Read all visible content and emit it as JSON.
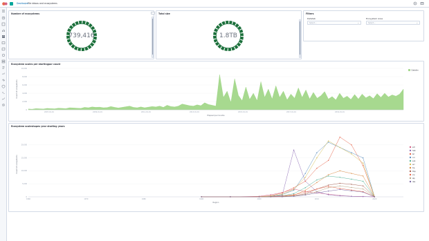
{
  "header": {
    "breadcrumb_root": "Dashboard",
    "breadcrumb_sep": "/",
    "breadcrumb_current": "File ddoos and ecosystems"
  },
  "panels": {
    "count": {
      "title": "Number of ecosystems",
      "value": "739,416",
      "button_label": "..."
    },
    "size": {
      "title": "Total size",
      "value": "1.8TB"
    },
    "filters": {
      "title": "Filters",
      "control1_label": "Datatab",
      "control1_placeholder": "Select...",
      "control2_label": "Ecosystem Area",
      "control2_placeholder": "Select..."
    }
  },
  "colors": {
    "accent": "#1a6f3a",
    "area": "#a7d98f",
    "brand": "#e7664c"
  },
  "chart_data": [
    {
      "type": "area",
      "title": "Ecosystem scales per startingpar count",
      "xlabel": "Elapsed per bundle",
      "ylabel": "Count of ecosystems",
      "ylim": [
        0,
        10000
      ],
      "y_ticks": [
        "10,000",
        "8,000",
        "6,000",
        "4,000",
        "2,000",
        "0"
      ],
      "x_ticks": [
        "2007-01-01",
        "2009-01-01",
        "2011-01-01",
        "2013-01-01",
        "2015-01-01",
        "2017-01-01",
        "2019-01-01"
      ],
      "legend": [
        "Datalim"
      ],
      "legend_position": "top-right",
      "x": [
        0,
        2,
        4,
        6,
        8,
        10,
        12,
        14,
        16,
        18,
        20,
        22,
        24,
        26,
        28,
        30,
        32,
        34,
        36,
        38,
        40,
        42,
        44,
        46,
        48,
        50,
        52,
        54,
        56,
        58,
        60,
        62,
        64,
        66,
        68,
        70,
        72,
        74,
        76,
        78,
        80,
        82,
        84,
        86,
        88,
        90,
        92,
        94,
        96,
        98,
        100,
        102,
        104,
        106,
        108,
        110,
        112,
        114,
        116,
        118,
        120,
        122,
        124,
        126,
        128,
        130,
        132,
        134,
        136,
        138,
        140,
        142,
        144,
        146,
        148,
        150,
        152,
        154,
        156,
        158,
        160,
        162,
        164,
        166,
        168,
        170,
        172,
        174,
        176,
        178,
        180,
        182,
        184,
        186,
        188,
        190,
        192,
        194,
        196,
        198,
        200
      ],
      "values": [
        200,
        150,
        300,
        250,
        200,
        350,
        300,
        250,
        400,
        350,
        300,
        500,
        450,
        400,
        350,
        600,
        500,
        700,
        600,
        650,
        500,
        550,
        800,
        600,
        450,
        600,
        750,
        900,
        600,
        500,
        700,
        500,
        650,
        800,
        700,
        900,
        600,
        1100,
        800,
        700,
        900,
        1400,
        1200,
        1000,
        900,
        1200,
        1000,
        1700,
        1300,
        1100,
        900,
        8500,
        3000,
        4500,
        1800,
        7500,
        3500,
        2200,
        5500,
        2500,
        4000,
        2200,
        6800,
        3000,
        5000,
        2600,
        5800,
        3000,
        4500,
        2400,
        3800,
        2800,
        5300,
        3000,
        4800,
        2600,
        4200,
        2800,
        3400,
        4400,
        2600,
        3200,
        2400,
        4000,
        2800,
        3300,
        2500,
        3700,
        2600,
        3800,
        2900,
        3400,
        2700,
        3900,
        3000,
        4000,
        3100,
        3600,
        3300,
        3800,
        5000
      ]
    },
    {
      "type": "line",
      "title": "Ecosystem scaleshapes year starting years",
      "xlabel": "Region",
      "ylabel": "Count of ecosystems",
      "ylim": [
        0,
        25000
      ],
      "y_ticks": [
        "20,000",
        "15,000",
        "10,000",
        "5,000",
        "0"
      ],
      "x_ticks": [
        "1960",
        "1970",
        "1980",
        "1990",
        "2000",
        "2010",
        "2020"
      ],
      "legend_position": "right",
      "x": [
        1990,
        1995,
        2000,
        2002,
        2004,
        2006,
        2008,
        2010,
        2012,
        2014,
        2016,
        2018,
        2020
      ],
      "series": [
        {
          "name": "sch",
          "color": "#d36086",
          "values": [
            0,
            0,
            200,
            800,
            1600,
            3000,
            2000,
            1500,
            1000,
            500,
            200,
            100,
            0
          ]
        },
        {
          "name": "hab",
          "color": "#9170b8",
          "values": [
            0,
            0,
            0,
            200,
            600,
            18000,
            6000,
            2000,
            800,
            400,
            200,
            100,
            0
          ]
        },
        {
          "name": "brl",
          "color": "#e7664c",
          "values": [
            0,
            0,
            100,
            400,
            1500,
            3500,
            6000,
            11000,
            14000,
            23000,
            20000,
            12000,
            0
          ]
        },
        {
          "name": "cor",
          "color": "#6092c0",
          "values": [
            0,
            0,
            0,
            300,
            900,
            2500,
            9000,
            17000,
            21000,
            19000,
            17000,
            15000,
            0
          ]
        },
        {
          "name": "sub",
          "color": "#54b399",
          "values": [
            0,
            0,
            0,
            100,
            400,
            1200,
            3500,
            6500,
            8000,
            7500,
            6800,
            6000,
            0
          ]
        },
        {
          "name": "arc",
          "color": "#d6bf57",
          "values": [
            0,
            0,
            100,
            300,
            1000,
            2800,
            7500,
            15000,
            21500,
            19000,
            16500,
            13000,
            0
          ]
        },
        {
          "name": "trp",
          "color": "#da8b45",
          "values": [
            0,
            0,
            0,
            0,
            200,
            600,
            2500,
            5500,
            8500,
            10000,
            9000,
            8000,
            0
          ]
        },
        {
          "name": "tmp",
          "color": "#aa6556",
          "values": [
            0,
            0,
            0,
            0,
            100,
            400,
            1200,
            3000,
            4500,
            5200,
            4800,
            4200,
            0
          ]
        },
        {
          "name": "ice",
          "color": "#e7664c",
          "values": [
            0,
            0,
            0,
            100,
            300,
            800,
            1800,
            3000,
            4000,
            3200,
            2600,
            2000,
            0
          ]
        },
        {
          "name": "alp",
          "color": "#b9a888",
          "values": [
            0,
            0,
            0,
            0,
            100,
            300,
            900,
            2000,
            3500,
            4200,
            3600,
            3000,
            0
          ]
        },
        {
          "name": "des",
          "color": "#7e6ca8",
          "values": [
            0,
            0,
            0,
            0,
            0,
            200,
            700,
            1500,
            2200,
            2800,
            2300,
            1800,
            0
          ]
        }
      ]
    }
  ]
}
